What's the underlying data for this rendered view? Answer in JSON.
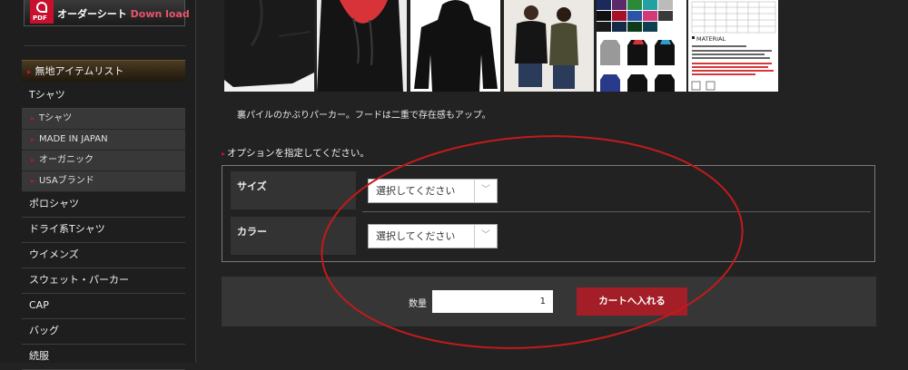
{
  "sidebar": {
    "pdf_banner": {
      "icon_text": "PDF",
      "label_main": "オーダーシート",
      "label_accent": "Down load"
    },
    "category_header": "無地アイテムリスト",
    "items": [
      {
        "label": "Tシャツ"
      },
      {
        "label": "Tシャツ",
        "sub": true
      },
      {
        "label": "MADE IN JAPAN",
        "sub": true
      },
      {
        "label": "オーガニック",
        "sub": true
      },
      {
        "label": "USAブランド",
        "sub": true
      },
      {
        "label": "ポロシャツ"
      },
      {
        "label": "ドライ系Tシャツ"
      },
      {
        "label": "ウイメンズ"
      },
      {
        "label": "スウェット・パーカー"
      },
      {
        "label": "CAP"
      },
      {
        "label": "バッグ"
      },
      {
        "label": "続服"
      }
    ]
  },
  "product": {
    "thumbnails": [
      {
        "alt": "hoodie-pocket-detail"
      },
      {
        "alt": "hoodie-red-hood-detail"
      },
      {
        "alt": "hoodie-back"
      },
      {
        "alt": "models-wearing-hoodies"
      },
      {
        "alt": "color-swatches"
      },
      {
        "alt": "size-chart"
      }
    ],
    "size_chart_heading": "MATERIAL",
    "description": "裏パイルのかぶりパーカー。フードは二重で存在感もアップ。"
  },
  "options": {
    "title": "オプションを指定してください。",
    "size_label": "サイズ",
    "size_value": "選択してください",
    "color_label": "カラー",
    "color_value": "選択してください"
  },
  "cart": {
    "qty_label": "数量",
    "qty_value": "1",
    "button_label": "カートへ入れる"
  },
  "colors": {
    "accent_red": "#a31e26",
    "annotation_red": "#c41a1a",
    "background": "#222222"
  }
}
